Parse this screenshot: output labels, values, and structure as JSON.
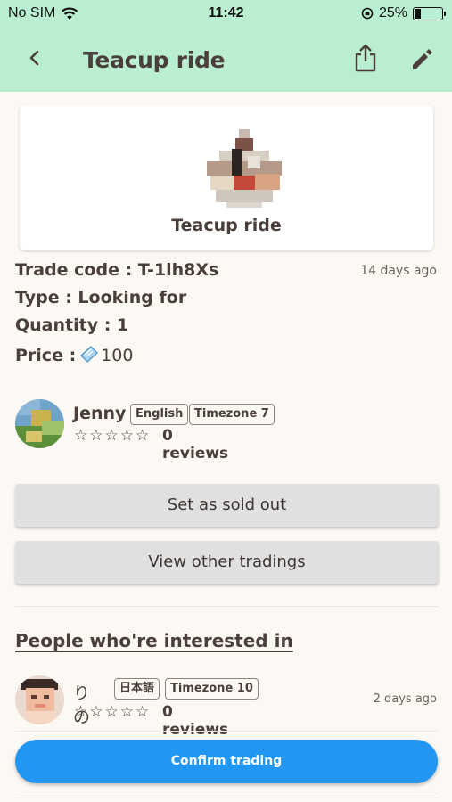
{
  "status_bar": {
    "carrier": "No SIM",
    "time": "11:42",
    "battery": "25%"
  },
  "app_bar": {
    "title": "Teacup ride"
  },
  "item_card": {
    "name": "Teacup ride"
  },
  "trade": {
    "code_label": "Trade code : T-1lh8Xs",
    "posted_ago": "14 days ago",
    "type_label": "Type : Looking for",
    "quantity_label": "Quantity : 1",
    "price_label": "Price :",
    "price_value": "100"
  },
  "owner": {
    "name": "Jenny",
    "language": "English",
    "timezone": "Timezone 7",
    "stars": "☆☆☆☆☆",
    "reviews": "0 reviews"
  },
  "actions": {
    "sold_out": "Set as sold out",
    "other_tradings": "View other tradings"
  },
  "interested": {
    "title": "People who're interested in",
    "users": [
      {
        "name": "りの",
        "language": "日本語",
        "timezone": "Timezone 10",
        "stars": "☆☆☆☆☆",
        "reviews": "0 reviews",
        "ago": "2 days ago"
      }
    ]
  },
  "confirm_button": "Confirm trading"
}
